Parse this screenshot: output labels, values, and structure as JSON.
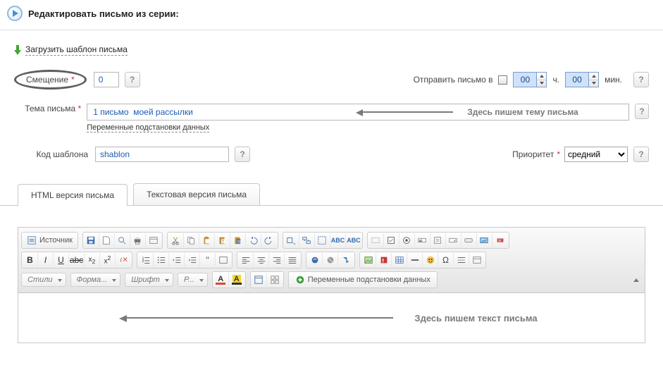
{
  "header": {
    "title": "Редактировать письмо из серии:"
  },
  "template_link": "Загрузить шаблон письма",
  "offset": {
    "label": "Смещение",
    "value": "0",
    "send_label": "Отправить письмо в",
    "enabled": false,
    "hours": "00",
    "hours_suffix": "ч.",
    "minutes": "00",
    "minutes_suffix": "мин."
  },
  "subject": {
    "label": "Тема письма",
    "value": "1 письмо  моей рассылки",
    "hint": "Здесь пишем тему  письма",
    "vars_link": "Переменные подстановки данных"
  },
  "template_code": {
    "label": "Код шаблона",
    "value": "shablon"
  },
  "priority": {
    "label": "Приоритет",
    "value": "средний"
  },
  "tabs": {
    "html": "HTML версия письма",
    "text": "Текстовая версия письма"
  },
  "editor": {
    "source": "Источник",
    "styles": "Стили",
    "format": "Форма...",
    "font": "Шрифт",
    "size": "Р...",
    "vars_button": "Переменные подстановки данных",
    "body_hint": "Здесь пишем  текст письма"
  },
  "help_glyph": "?"
}
